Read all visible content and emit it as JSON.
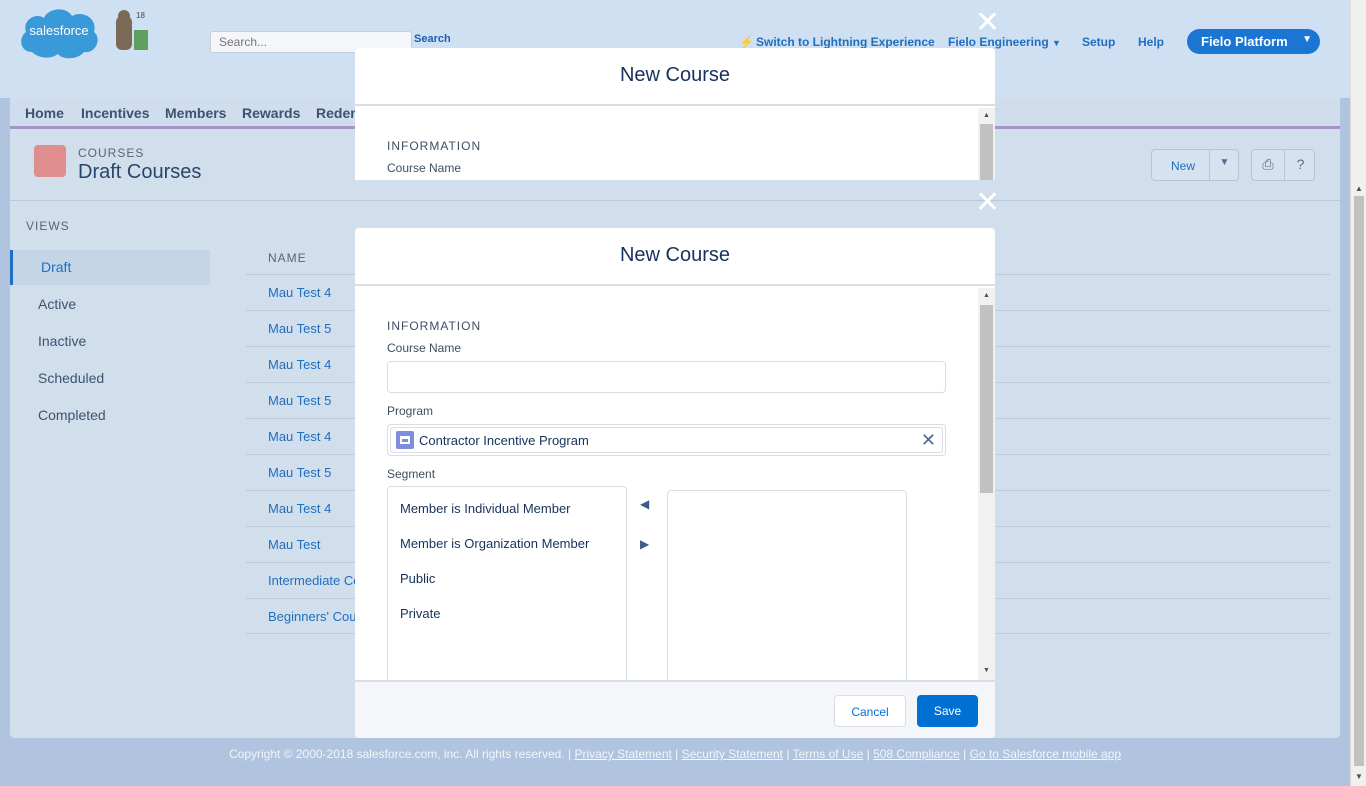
{
  "header": {
    "search_placeholder": "Search...",
    "search_button": "Search",
    "links": [
      "Switch to Lightning Experience",
      "Fielo Engineering",
      "Setup",
      "Help"
    ],
    "app_switcher": "Fielo Platform"
  },
  "tabs": [
    "Home",
    "Incentives",
    "Members",
    "Rewards",
    "Redem"
  ],
  "page": {
    "object_label": "COURSES",
    "title": "Draft Courses",
    "new_button": "New"
  },
  "views": {
    "title": "VIEWS",
    "items": [
      "Draft",
      "Active",
      "Inactive",
      "Scheduled",
      "Completed"
    ],
    "active": "Draft"
  },
  "list": {
    "column": "NAME",
    "rows": [
      "Mau Test 4",
      "Mau Test 5",
      "Mau Test 4",
      "Mau Test 5",
      "Mau Test 4",
      "Mau Test 5",
      "Mau Test 4",
      "Mau Test",
      "Intermediate Co",
      "Beginners' Cou"
    ]
  },
  "footer": {
    "copyright": "Copyright © 2000-2018 salesforce.com, inc. All rights reserved. |",
    "links": [
      "Privacy Statement",
      "Security Statement",
      "Terms of Use",
      "508 Compliance",
      "Go to Salesforce mobile app"
    ]
  },
  "modal_back": {
    "title": "New Course",
    "section": "INFORMATION",
    "field_label": "Course Name"
  },
  "modal": {
    "title": "New Course",
    "section": "INFORMATION",
    "course_name_label": "Course Name",
    "course_name_value": "",
    "program_label": "Program",
    "program_value": "Contractor Incentive Program",
    "segment_label": "Segment",
    "segment_options": [
      "Member is Individual Member",
      "Member is Organization Member",
      "Public",
      "Private"
    ],
    "cancel": "Cancel",
    "save": "Save"
  },
  "colors": {
    "brand": "#0070d2",
    "overlay": "#b0c4df"
  }
}
